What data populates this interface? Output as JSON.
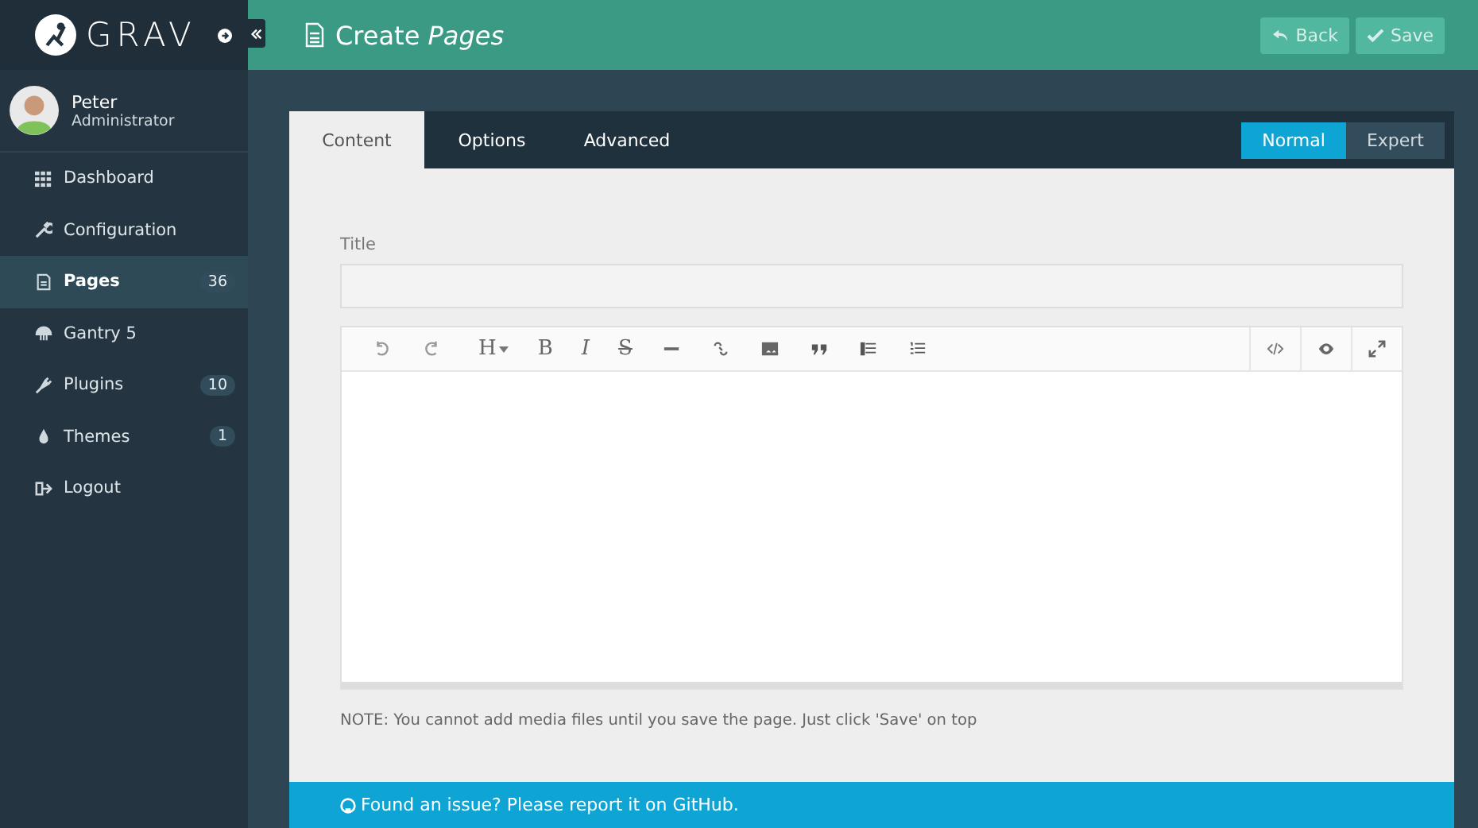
{
  "logo": {
    "text": "GRAV"
  },
  "user": {
    "name": "Peter",
    "role": "Administrator"
  },
  "sidebar": {
    "items": [
      {
        "label": "Dashboard",
        "selected": false
      },
      {
        "label": "Configuration",
        "selected": false
      },
      {
        "label": "Pages",
        "selected": true,
        "badge": "36"
      },
      {
        "label": "Gantry 5",
        "selected": false
      },
      {
        "label": "Plugins",
        "selected": false,
        "badge": "10"
      },
      {
        "label": "Themes",
        "selected": false,
        "badge": "1"
      },
      {
        "label": "Logout",
        "selected": false
      }
    ]
  },
  "header": {
    "title": "Create *Pages*",
    "buttons": [
      {
        "label": "Back"
      },
      {
        "label": "Save"
      }
    ]
  },
  "tabs": [
    {
      "label": "Content",
      "selected": true
    },
    {
      "label": "Options",
      "selected": false
    },
    {
      "label": "Advanced",
      "selected": false
    }
  ],
  "mode": [
    {
      "label": "Normal",
      "selected": true
    },
    {
      "label": "Expert",
      "selected": false
    }
  ],
  "title_field": {
    "label": "Title"
  },
  "toolbar": [
    {
      "kind": "icon"
    },
    {
      "kind": "icon"
    },
    {
      "kind": "glyph",
      "label": "H"
    },
    {
      "kind": "glyph",
      "label": "B"
    },
    {
      "kind": "glyph",
      "label": "I"
    },
    {
      "kind": "glyph",
      "label": "S"
    },
    {
      "kind": "icon"
    },
    {
      "kind": "icon"
    },
    {
      "kind": "icon"
    },
    {
      "kind": "icon"
    },
    {
      "kind": "icon"
    },
    {
      "kind": "icon"
    }
  ],
  "toolbar_right": [
    {
      "kind": "icon"
    },
    {
      "kind": "icon"
    },
    {
      "kind": "icon"
    }
  ],
  "note": "NOTE: You cannot add media files until you save the page. Just click 'Save' on top",
  "footer": {
    "text": "Found an issue? Please report it on GitHub."
  }
}
